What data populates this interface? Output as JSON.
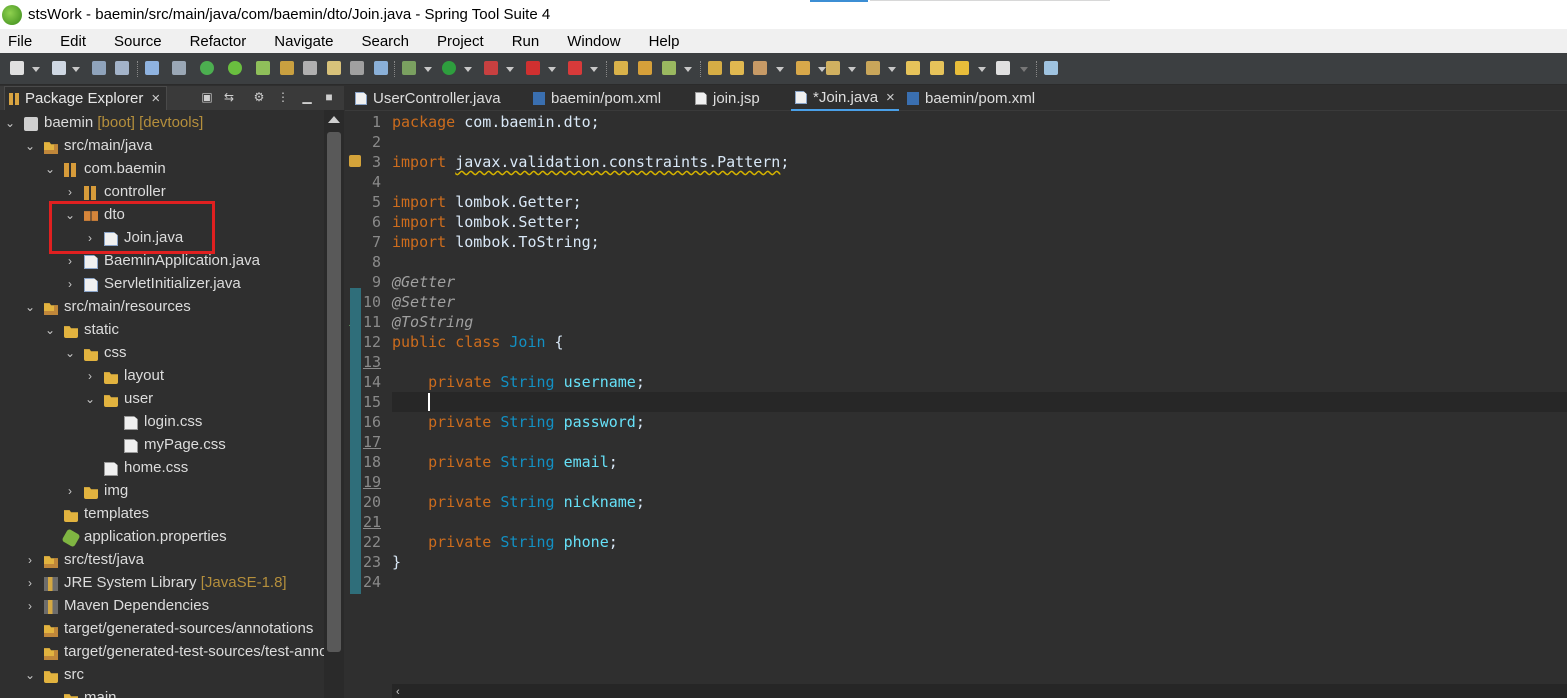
{
  "window": {
    "title": "stsWork - baemin/src/main/java/com/baemin/dto/Join.java - Spring Tool Suite 4"
  },
  "menubar": {
    "items": [
      "File",
      "Edit",
      "Source",
      "Refactor",
      "Navigate",
      "Search",
      "Project",
      "Run",
      "Window",
      "Help"
    ]
  },
  "package_explorer": {
    "tab_label": "Package Explorer",
    "tree": [
      {
        "label": "baemin",
        "decor": "[boot] [devtools]",
        "icon": "project-icon"
      },
      {
        "label": "src/main/java",
        "icon": "source-folder-icon"
      },
      {
        "label": "com.baemin",
        "icon": "package-icon"
      },
      {
        "label": "controller",
        "icon": "package-icon"
      },
      {
        "label": "dto",
        "icon": "package-icon"
      },
      {
        "label": "Join.java",
        "icon": "java-file-icon"
      },
      {
        "label": "BaeminApplication.java",
        "icon": "java-file-icon"
      },
      {
        "label": "ServletInitializer.java",
        "icon": "java-file-icon"
      },
      {
        "label": "src/main/resources",
        "icon": "source-folder-icon"
      },
      {
        "label": "static",
        "icon": "folder-icon"
      },
      {
        "label": "css",
        "icon": "folder-icon"
      },
      {
        "label": "layout",
        "icon": "folder-icon"
      },
      {
        "label": "user",
        "icon": "folder-icon"
      },
      {
        "label": "login.css",
        "icon": "css-file-icon"
      },
      {
        "label": "myPage.css",
        "icon": "css-file-icon"
      },
      {
        "label": "home.css",
        "icon": "css-file-icon"
      },
      {
        "label": "img",
        "icon": "folder-icon"
      },
      {
        "label": "templates",
        "icon": "folder-icon"
      },
      {
        "label": "application.properties",
        "icon": "properties-file-icon"
      },
      {
        "label": "src/test/java",
        "icon": "source-folder-icon"
      },
      {
        "label": "JRE System Library",
        "decor": "[JavaSE-1.8]",
        "icon": "library-icon"
      },
      {
        "label": "Maven Dependencies",
        "icon": "library-icon"
      },
      {
        "label": "target/generated-sources/annotations",
        "icon": "source-folder-icon"
      },
      {
        "label": "target/generated-test-sources/test-annotations",
        "icon": "source-folder-icon"
      },
      {
        "label": "src",
        "icon": "folder-icon"
      },
      {
        "label": "main",
        "icon": "folder-icon"
      }
    ]
  },
  "editor": {
    "tabs": [
      {
        "label": "UserController.java",
        "icon": "java-file-icon"
      },
      {
        "label": "baemin/pom.xml",
        "icon": "maven-icon"
      },
      {
        "label": "join.jsp",
        "icon": "jsp-file-icon"
      },
      {
        "label": "*Join.java",
        "icon": "java-file-icon",
        "active": true
      },
      {
        "label": "baemin/pom.xml",
        "icon": "maven-icon"
      }
    ],
    "line_numbers": [
      "1",
      "2",
      "3",
      "4",
      "5",
      "6",
      "7",
      "8",
      "9",
      "10",
      "11",
      "12",
      "13",
      "14",
      "15",
      "16",
      "17",
      "18",
      "19",
      "20",
      "21",
      "22",
      "23",
      "24"
    ],
    "code": {
      "l1_kw": "package",
      "l1_rest": " com.baemin.dto;",
      "l3_kw": "import",
      "l3_warn": "javax.validation.constraints.Pattern",
      "l3_end": ";",
      "l5_kw": "import",
      "l5_rest": " lombok.Getter;",
      "l6_kw": "import",
      "l6_rest": " lombok.Setter;",
      "l7_kw": "import",
      "l7_rest": " lombok.ToString;",
      "l9": "@Getter",
      "l10": "@Setter",
      "l11": "@ToString",
      "l12_kw": "public class",
      "l12_cls": "Join",
      "l12_end": " {",
      "private": "private",
      "string": "String",
      "f14": "username",
      "f16": "password",
      "f18": "email",
      "f20": "nickname",
      "f22": "phone",
      "semicolon": ";",
      "l23": "}"
    }
  },
  "colors": {
    "keyword": "#cc6c1d",
    "type": "#1290c3",
    "field": "#66e1f8",
    "annotation": "#a0a0a0",
    "highlight_box": "#e02020"
  }
}
